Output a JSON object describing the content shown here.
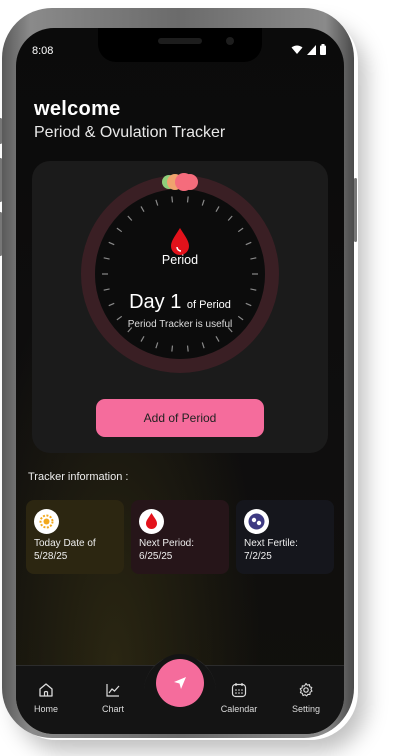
{
  "status_bar": {
    "time": "8:08"
  },
  "header": {
    "greeting": "welcome",
    "title": "Period & Ovulation Tracker"
  },
  "cycle_card": {
    "center_label": "Period",
    "day_prefix": "Day",
    "day_number": "1",
    "day_suffix": "of Period",
    "caption": "Period Tracker is useful",
    "add_button": "Add of Period"
  },
  "tracker": {
    "heading": "Tracker information :",
    "tiles": [
      {
        "line1": "Today Date of",
        "line2": "5/28/25",
        "icon": "sun-calendar-icon"
      },
      {
        "line1": "Next Period:",
        "line2": "6/25/25",
        "icon": "blood-drop-icon"
      },
      {
        "line1": "Next Fertile:",
        "line2": "7/2/25",
        "icon": "egg-cells-icon"
      }
    ]
  },
  "nav": {
    "items": [
      {
        "label": "Home",
        "icon": "home-icon"
      },
      {
        "label": "Chart",
        "icon": "chart-icon"
      },
      {
        "label": "Calendar",
        "icon": "calendar-icon"
      },
      {
        "label": "Setting",
        "icon": "gear-icon"
      }
    ],
    "fab_icon": "navigation-arrow-icon"
  },
  "colors": {
    "accent": "#f56c9c",
    "ring": "#3a1f24",
    "drop": "#e3121b"
  }
}
